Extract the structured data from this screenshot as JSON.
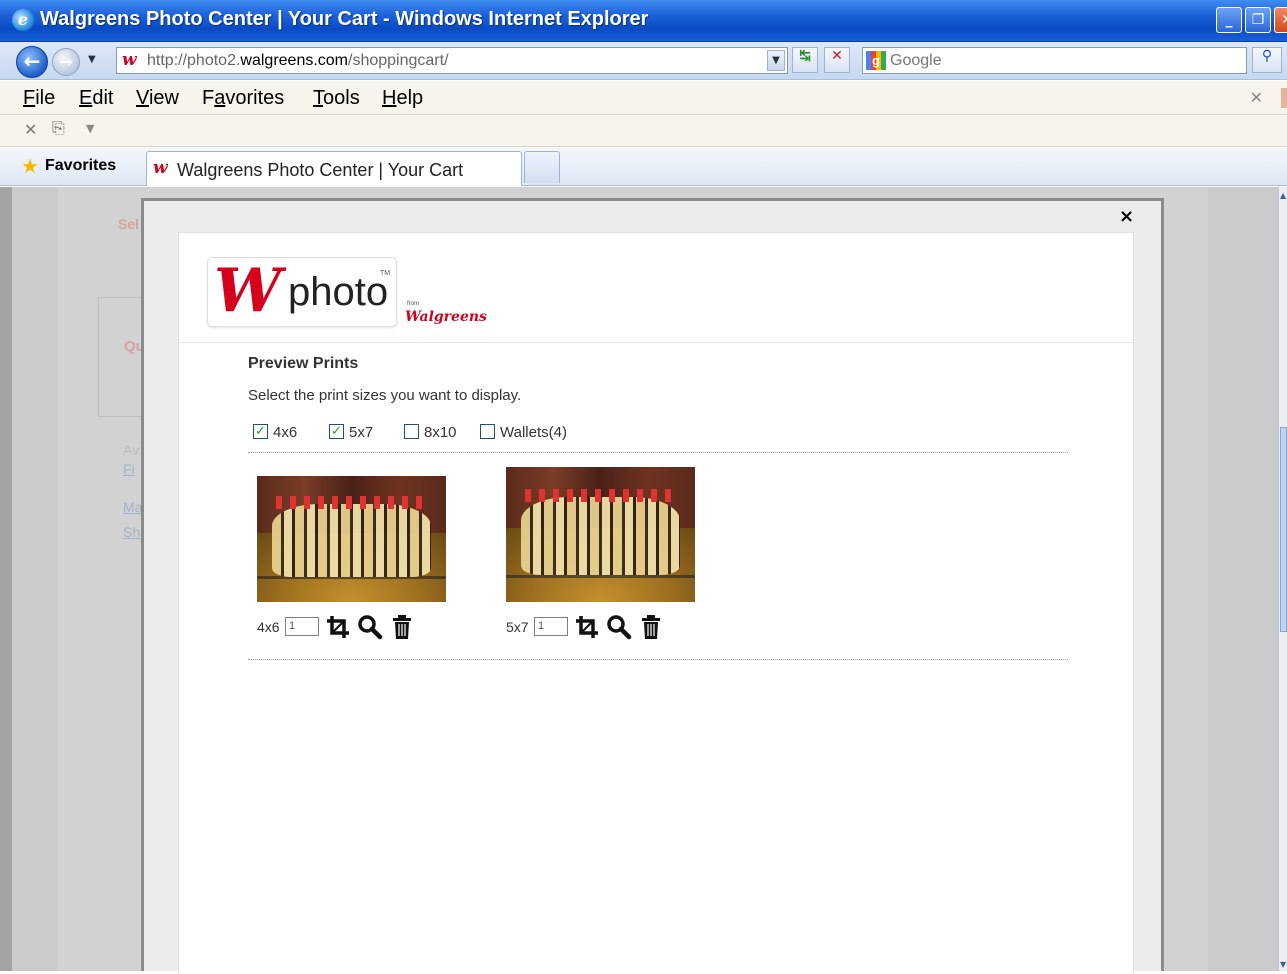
{
  "window": {
    "title": "Walgreens Photo Center | Your Cart - Windows Internet Explorer",
    "buttons": {
      "minimize": "_",
      "restore": "❐",
      "close": "✕"
    }
  },
  "address_bar": {
    "url_prefix": "http://photo2.",
    "url_domain": "walgreens.com",
    "url_path": "/shoppingcart/",
    "search_placeholder": "Google"
  },
  "menu": {
    "items": [
      {
        "label": "File",
        "u": "F",
        "rest": "ile"
      },
      {
        "label": "Edit",
        "u": "E",
        "rest": "dit"
      },
      {
        "label": "View",
        "u": "V",
        "rest": "iew"
      },
      {
        "label": "Favorites",
        "pre": "F",
        "u": "a",
        "rest": "vorites"
      },
      {
        "label": "Tools",
        "u": "T",
        "rest": "ools"
      },
      {
        "label": "Help",
        "u": "H",
        "rest": "elp"
      }
    ]
  },
  "favorites_bar": {
    "label": "Favorites",
    "tab_title": "Walgreens Photo Center | Your Cart"
  },
  "background_page": {
    "ghost_text": [
      "Sel",
      "Qu",
      "Av",
      "Fi",
      "Ma",
      "Sh"
    ]
  },
  "modal": {
    "close": "×",
    "logo": {
      "w": "W",
      "photo": "photo",
      "tm": "TM",
      "from": "from",
      "brand": "Walgreens"
    },
    "heading": "Preview Prints",
    "instruction": "Select the print sizes you want to display.",
    "sizes": [
      {
        "label": "4x6",
        "checked": true
      },
      {
        "label": "5x7",
        "checked": true
      },
      {
        "label": "8x10",
        "checked": false
      },
      {
        "label": "Wallets(4)",
        "checked": false
      }
    ],
    "prints": [
      {
        "size": "4x6",
        "quantity": "1"
      },
      {
        "size": "5x7",
        "quantity": "1"
      }
    ]
  }
}
